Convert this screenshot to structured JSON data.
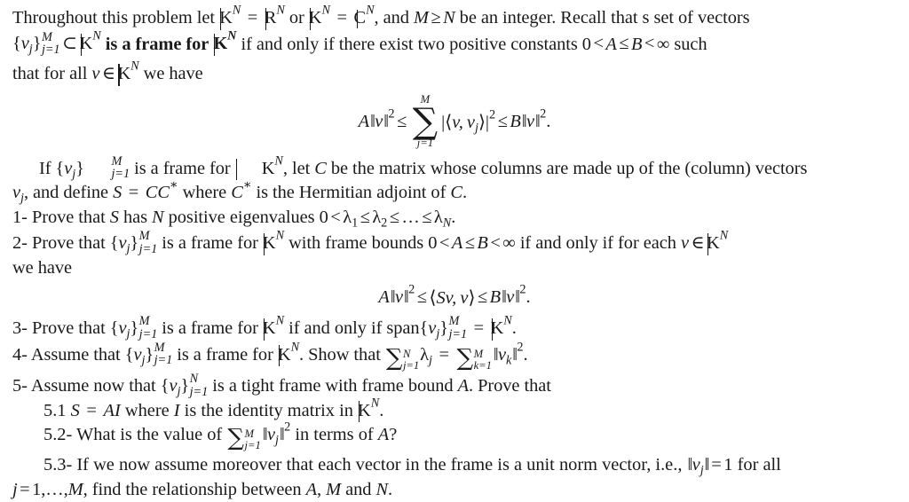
{
  "document": {
    "type": "mathematics-problem-set",
    "topic": "Frames in finite dimensional Hilbert spaces",
    "background_color": "#ffffff",
    "text_color": "#1a1a1a"
  },
  "intro": {
    "p1_a": "Throughout this problem let ",
    "p1_b": " = ",
    "p1_c": " or ",
    "p1_d": " = ",
    "p1_e": ", and ",
    "p1_f": " be an integer. Recall that s set of vectors",
    "symbol_K": "K",
    "symbol_R": "R",
    "symbol_C": "C",
    "exp_N": "N",
    "M_ge_N": "M ≥ N",
    "p2_set": "{v",
    "p2_sub": "j",
    "p2_close": "}",
    "p2_lim_up": "M",
    "p2_lim_down": "j=1",
    "p2_subset": "⊂",
    "p2_bold": "is a frame for",
    "p2_rest": "if and only if there exist two positive constants ",
    "p2_bounds": "0 < A ≤ B < ∞",
    "p2_tail": " such",
    "p3": "that for all ",
    "p3_v_in": "v ∈ ",
    "p3_tail": " we have"
  },
  "eq1": {
    "lhs_A": "A",
    "norm_open": "‖",
    "norm_var": "v",
    "norm_close": "‖",
    "exp2": "2",
    "le1": "≤",
    "sum_top": "M",
    "sum_sigma": "∑",
    "sum_bottom": "j=1",
    "inner_open": "|⟨",
    "inner_v": "v,",
    "inner_vj": "v",
    "inner_j": "j",
    "inner_close": "⟩|",
    "le2": "≤",
    "rhs_B": "B",
    "period": "."
  },
  "para2": {
    "a": "If ",
    "set_open": "{v",
    "set_sub": "j",
    "set_close": "}",
    "lim_up": "M",
    "lim_down": "j=1",
    "b": " is a frame for ",
    "c": ", let ",
    "C": "C",
    "d": " be the matrix whose columns are made up of the (column) vectors",
    "e": ", and define ",
    "S": "S",
    "eq": " = ",
    "CCstar": "CC",
    "star": "∗",
    "f": " where ",
    "g": " is the Hermitian adjoint of ",
    "h": "."
  },
  "items": [
    {
      "id": "item-1",
      "label": "1- ",
      "text_a": "Prove that ",
      "S": "S",
      "text_b": " has ",
      "N": "N",
      "text_c": " positive eigenvalues ",
      "math": "0 < λ1 ≤ λ2 ≤ … ≤ λN",
      "lambda": "λ",
      "sub1": "1",
      "sub2": "2",
      "subN": "N",
      "zero_lt": "0 <",
      "le": "≤",
      "dots": "…",
      "period": "."
    },
    {
      "id": "item-2",
      "label": "2- ",
      "text_a": "Prove that ",
      "text_b": " is a frame for ",
      "text_c": " with frame bounds ",
      "bounds": "0 < A ≤ B < ∞",
      "text_d": " if and only if for each ",
      "text_e": "v ∈ ",
      "text_f": "we have"
    },
    {
      "id": "item-3",
      "label": "3- ",
      "text_a": "Prove that ",
      "text_b": " is a frame for ",
      "text_c": " if and only if span",
      "text_d": " = ",
      "period": "."
    },
    {
      "id": "item-4",
      "label": "4- ",
      "text_a": "Assume that ",
      "text_b": " is a frame for ",
      "text_c": ". Show that ",
      "sum1_top": "N",
      "sum1_bottom": "j=1",
      "lambda_j": "λ",
      "sub_j": "j",
      "eq": " = ",
      "sum2_top": "M",
      "sum2_bottom": "k=1",
      "norm_vk": "v",
      "sub_k": "k",
      "exp2": "2",
      "period": "."
    },
    {
      "id": "item-5",
      "label": "5- ",
      "text_a": "Assume now that ",
      "lim_up": "N",
      "lim_down": "j=1",
      "text_b": " is a tight frame with frame bound ",
      "A": "A",
      "text_c": ". Prove that"
    }
  ],
  "subitems": [
    {
      "id": "item-5-1",
      "label": "5.1 ",
      "text_a": "S",
      "eq": " = ",
      "AI": "AI",
      "text_b": " where ",
      "I": "I",
      "text_c": " is the identity matrix in ",
      "period": "."
    },
    {
      "id": "item-5-2",
      "label": "5.2- ",
      "text_a": "What is the value of ",
      "sum_top": "M",
      "sum_bottom": "j=1",
      "norm_vj": "v",
      "sub_j": "j",
      "exp2": "2",
      "text_b": " in terms of ",
      "A": "A",
      "question": "?"
    },
    {
      "id": "item-5-3",
      "label": "5.3- ",
      "text_a": "If we now assume moreover that each vector in the frame is a unit norm vector, i.e., ",
      "norm_vj": "v",
      "sub_j": "j",
      "eq_one": " = 1",
      "text_b": " for all",
      "text_c": "j = 1,…,M",
      "text_d": ", find the relationship between ",
      "A": "A",
      "comma": ", ",
      "M": "M",
      "and": " and ",
      "N": "N",
      "period": "."
    }
  ],
  "eq2": {
    "lhs_A": "A",
    "norm_open": "‖",
    "norm_var": "v",
    "norm_close": "‖",
    "exp2": "2",
    "le1": "≤",
    "angle_open": "⟨",
    "Sv": "Sv,",
    "v": "v",
    "angle_close": "⟩",
    "le2": "≤",
    "rhs_B": "B",
    "period": "."
  }
}
